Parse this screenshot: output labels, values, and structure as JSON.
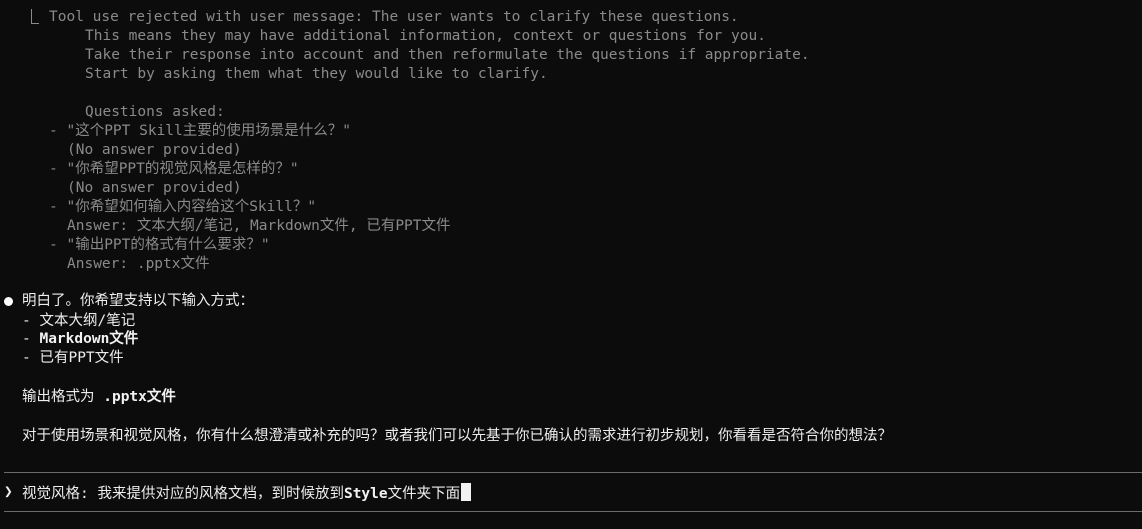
{
  "tool_result": {
    "header": "Tool use rejected with user message: The user wants to clarify these questions.",
    "lines": [
      "This means they may have additional information, context or questions for you.",
      "Take their response into account and then reformulate the questions if appropriate.",
      "Start by asking them what they would like to clarify."
    ],
    "questions_label": "Questions asked:",
    "questions": [
      {
        "question": "- \"这个PPT Skill主要的使用场景是什么？\"",
        "answer": "(No answer provided)"
      },
      {
        "question": "- \"你希望PPT的视觉风格是怎样的？\"",
        "answer": "(No answer provided)"
      },
      {
        "question": "- \"你希望如何输入内容给这个Skill？\"",
        "answer": "Answer: 文本大纲/笔记, Markdown文件, 已有PPT文件"
      },
      {
        "question": "- \"输出PPT的格式有什么要求？\"",
        "answer": "Answer: .pptx文件"
      }
    ]
  },
  "assistant": {
    "intro": "明白了。你希望支持以下输入方式：",
    "input_methods": [
      {
        "prefix": "- ",
        "text": "文本大纲/笔记"
      },
      {
        "prefix": "- ",
        "text": "Markdown文件"
      },
      {
        "prefix": "- ",
        "text": "已有PPT文件"
      }
    ],
    "output_label": "输出格式为 ",
    "output_value": ".pptx文件",
    "followup": "对于使用场景和视觉风格，你有什么想澄清或补充的吗？或者我们可以先基于你已确认的需求进行初步规划，你看看是否符合你的想法？"
  },
  "prompt": {
    "chevron": "❯",
    "input_prefix": "视觉风格: 我来提供对应的风格文档，到时候放到",
    "input_keyword": "Style",
    "input_suffix": "文件夹下面"
  }
}
